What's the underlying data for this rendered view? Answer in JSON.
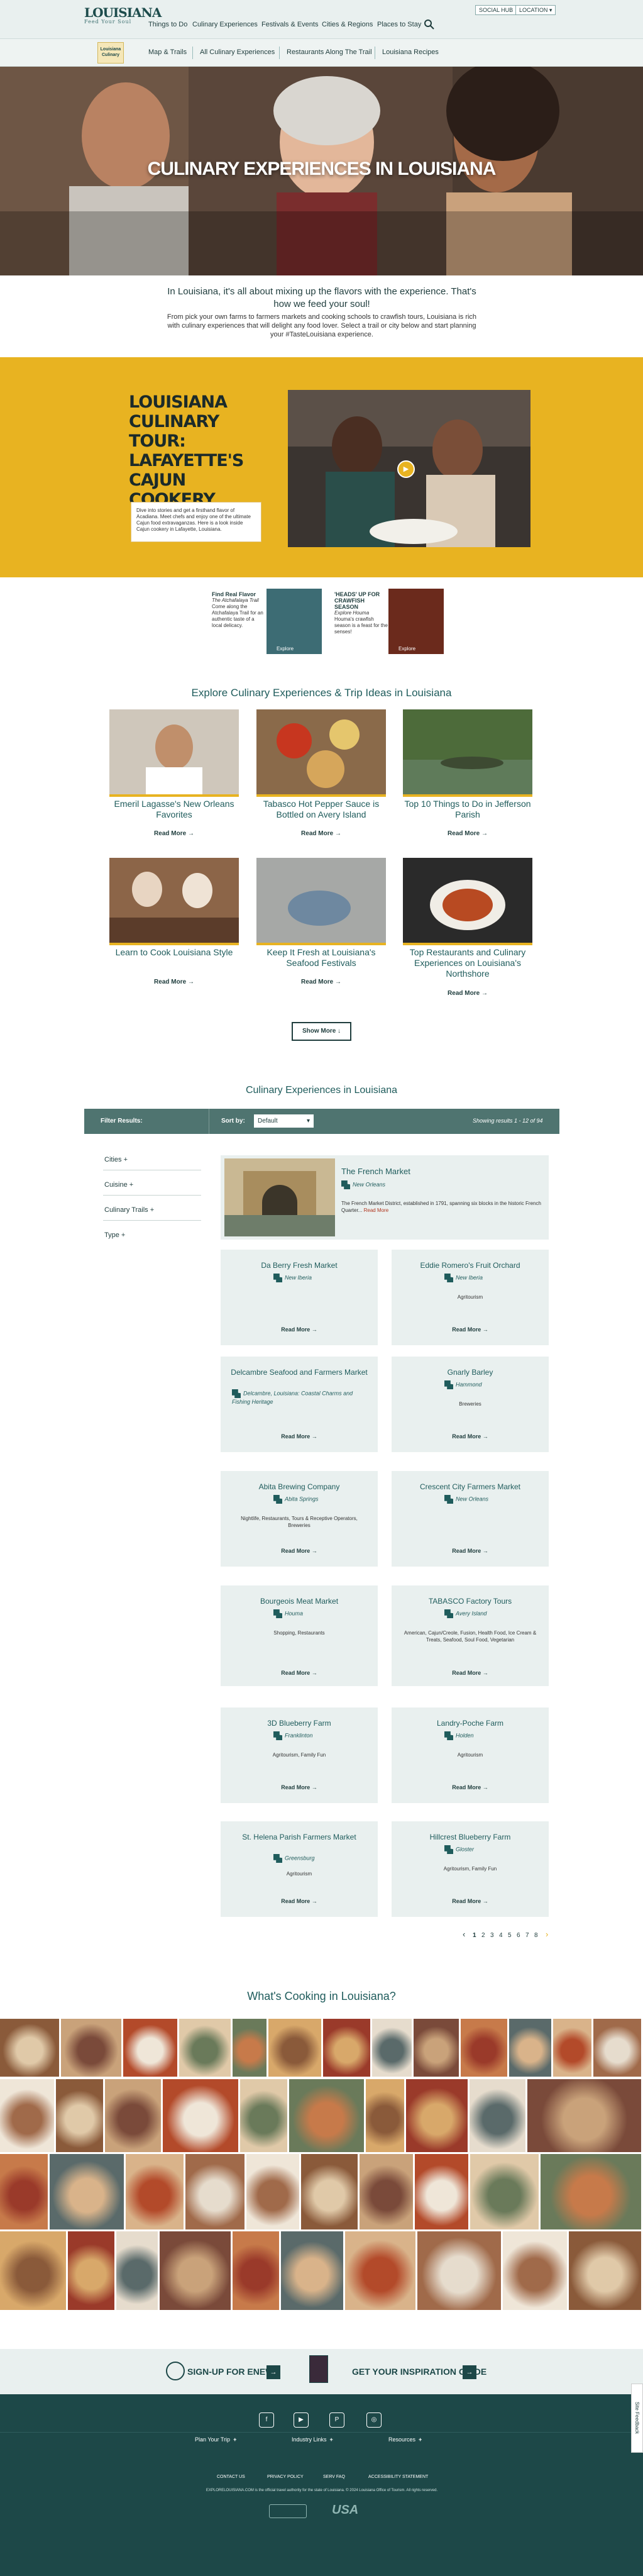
{
  "header": {
    "logo": "LOUISIANA",
    "logo_tag": "Feed Your Soul",
    "nav": [
      "Things to Do",
      "Culinary Experiences",
      "Festivals & Events",
      "Cities & Regions",
      "Places to Stay"
    ],
    "social_hub": "SOCIAL HUB",
    "location": "LOCATION",
    "subnav_logo": "Louisiana Culinary",
    "subnav": [
      "Map & Trails",
      "All Culinary Experiences",
      "Restaurants Along The Trail",
      "Louisiana Recipes"
    ]
  },
  "hero": {
    "title": "CULINARY EXPERIENCES IN LOUISIANA"
  },
  "intro": {
    "lead": "In Louisiana, it's all about mixing up the flavors with the experience. That's how we feed your soul!",
    "body": "From pick your own farms to farmers markets and cooking schools to crawfish tours, Louisiana is rich with culinary experiences that will delight any food lover. Select a trail or city below and start planning your #TasteLouisiana experience."
  },
  "feature": {
    "title": "LOUISIANA CULINARY TOUR: LAFAYETTE'S CAJUN COOKERY",
    "caption": "Dive into stories and get a firsthand flavor of Acadiana. Meet chefs and enjoy one of the ultimate Cajun food extravaganzas. Here is a look inside Cajun cookery in Lafayette, Louisiana."
  },
  "promos": [
    {
      "title": "Find Real Flavor",
      "subtitle": "The Atchafalaya Trail",
      "body": "Come along the Atchafalaya Trail for an authentic taste of a local delicacy.",
      "cta": "Explore"
    },
    {
      "title": "'HEADS' UP FOR CRAWFISH SEASON",
      "subtitle": "Explore Houma",
      "body": "Houma's crawfish season is a feast for the senses!",
      "cta": "Explore"
    }
  ],
  "explore": {
    "title": "Explore Culinary Experiences & Trip Ideas in Louisiana",
    "read_more": "Read More",
    "cards": [
      {
        "title": "Emeril Lagasse's New Orleans Favorites"
      },
      {
        "title": "Tabasco Hot Pepper Sauce is Bottled on Avery Island"
      },
      {
        "title": "Top 10 Things to Do in Jefferson Parish"
      },
      {
        "title": "Learn to Cook Louisiana Style"
      },
      {
        "title": "Keep It Fresh at Louisiana's Seafood Festivals"
      },
      {
        "title": "Top Restaurants and Culinary Experiences on Louisiana's Northshore"
      }
    ],
    "show_more": "Show More"
  },
  "listing": {
    "title": "Culinary Experiences in Louisiana",
    "filter_results": "Filter Results:",
    "sort_by": "Sort by:",
    "sort_value": "Default",
    "showing": "Showing results 1 - 12 of 94",
    "filters": [
      "Cities",
      "Cuisine",
      "Culinary Trails",
      "Type"
    ],
    "featured": {
      "name": "The French Market",
      "city": "New Orleans",
      "desc": "The French Market District, established in 1791, spanning six blocks in the historic French Quarter...",
      "read_more": "Read More"
    },
    "read_more": "Read More",
    "items": [
      {
        "name": "Da Berry Fresh Market",
        "city": "New Iberia",
        "cat": ""
      },
      {
        "name": "Eddie Romero's Fruit Orchard",
        "city": "New Iberia",
        "cat": "Agritourism"
      },
      {
        "name": "Delcambre Seafood and Farmers Market",
        "city": "Delcambre, Louisiana: Coastal Charms and Fishing Heritage",
        "cat": ""
      },
      {
        "name": "Gnarly Barley",
        "city": "Hammond",
        "cat": "Breweries"
      },
      {
        "name": "Abita Brewing Company",
        "city": "Abita Springs",
        "cat": "Nightlife, Restaurants, Tours & Receptive Operators, Breweries"
      },
      {
        "name": "Crescent City Farmers Market",
        "city": "New Orleans",
        "cat": ""
      },
      {
        "name": "Bourgeois Meat Market",
        "city": "Houma",
        "cat": "Shopping, Restaurants"
      },
      {
        "name": "TABASCO Factory Tours",
        "city": "Avery Island",
        "cat": "American, Cajun/Creole, Fusion, Health Food, Ice Cream & Treats, Seafood, Soul Food, Vegetarian"
      },
      {
        "name": "3D Blueberry Farm",
        "city": "Franklinton",
        "cat": "Agritourism, Family Fun"
      },
      {
        "name": "Landry-Poche Farm",
        "city": "Holden",
        "cat": "Agritourism"
      },
      {
        "name": "St. Helena Parish Farmers Market",
        "city": "Greensburg",
        "cat": "Agritourism"
      },
      {
        "name": "Hillcrest Blueberry Farm",
        "city": "Gloster",
        "cat": "Agritourism, Family Fun"
      }
    ],
    "pages": [
      "1",
      "2",
      "3",
      "4",
      "5",
      "6",
      "7",
      "8"
    ]
  },
  "social": {
    "title": "What's Cooking in Louisiana?"
  },
  "footer": {
    "signup": "SIGN-UP FOR ENEWS",
    "guide": "GET YOUR INSPIRATION GUIDE",
    "social_icons": [
      "facebook-icon",
      "youtube-icon",
      "pinterest-icon",
      "instagram-icon"
    ],
    "groups": [
      "Plan Your Trip",
      "Industry Links",
      "Resources"
    ],
    "links": [
      "CONTACT US",
      "PRIVACY POLICY",
      "SERV FAQ",
      "ACCESSIBILITY STATEMENT"
    ],
    "legal": "EXPLORELOUISIANA.COM is the official travel authority for the state of Louisiana. © 2024 Louisiana Office of Tourism. All rights reserved.",
    "feedback": "Site Feedback",
    "colors": {
      "teal": "#1d4848",
      "gold": "#e8b321",
      "mint": "#e9f0ef"
    }
  }
}
